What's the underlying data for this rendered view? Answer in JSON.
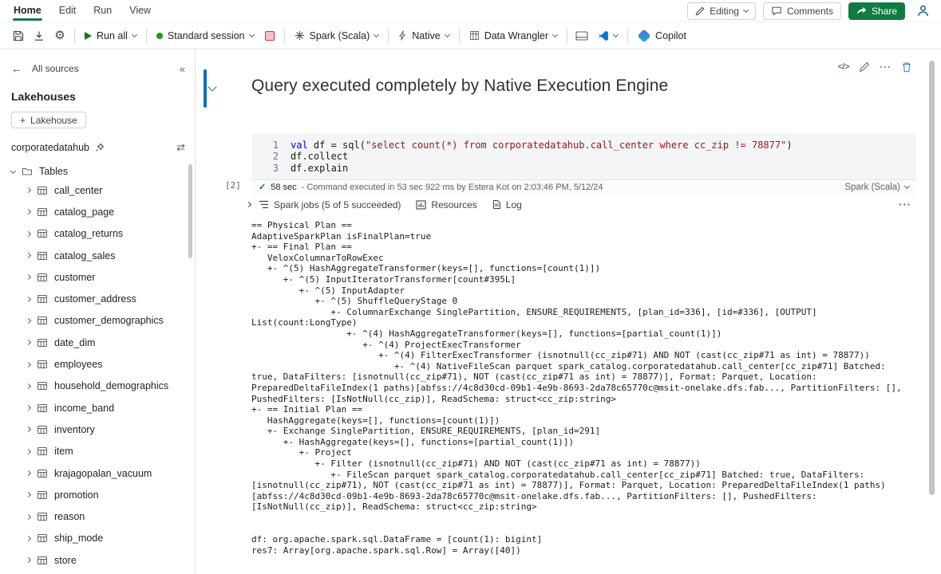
{
  "colors": {
    "accent_green": "#107c41",
    "tab_underline_green": "#117865",
    "run_green": "#107c10",
    "session_green": "#13a10e",
    "stop_red": "#d13438",
    "cell_accent_blue": "#0f6cbd",
    "keyword_blue": "#0000ff",
    "string_red": "#a31515",
    "vscode_blue": "#0078d4"
  },
  "icons": {
    "back": "←",
    "collapse_panel": "«",
    "plus": "+",
    "swap": "⇄",
    "gear": "⚙",
    "check": "✓",
    "code": "</>",
    "cell_more": "···",
    "output_more": "···"
  },
  "menubar": {
    "tabs": [
      "Home",
      "Edit",
      "Run",
      "View"
    ],
    "editing_label": "Editing",
    "comments_label": "Comments",
    "share_label": "Share"
  },
  "toolbar": {
    "run_all_label": "Run all",
    "session_label": "Standard session",
    "language_label": "Spark (Scala)",
    "native_label": "Native",
    "data_wrangler_label": "Data Wrangler",
    "copilot_label": "Copilot"
  },
  "sidebar": {
    "all_sources_label": "All sources",
    "section_title": "Lakehouses",
    "add_button_label": "Lakehouse",
    "lakehouse_name": "corporatedatahub",
    "tree_root_label": "Tables",
    "tables": [
      "call_center",
      "catalog_page",
      "catalog_returns",
      "catalog_sales",
      "customer",
      "customer_address",
      "customer_demographics",
      "date_dim",
      "employees",
      "household_demographics",
      "income_band",
      "inventory",
      "item",
      "krajagopalan_vacuum",
      "promotion",
      "reason",
      "ship_mode",
      "store"
    ]
  },
  "notebook": {
    "cell_title": "Query executed completely by Native Execution Engine",
    "execution_count": "[2]",
    "code_lines": [
      {
        "num": "1",
        "tokens": [
          {
            "t": "val",
            "c": "kw"
          },
          {
            "t": " df = sql(",
            "c": "plain"
          },
          {
            "t": "\"select count(*) from corporatedatahub.call_center where cc_zip != 78877\"",
            "c": "str"
          },
          {
            "t": ")",
            "c": "plain"
          }
        ]
      },
      {
        "num": "2",
        "tokens": [
          {
            "t": "df.collect",
            "c": "plain"
          }
        ]
      },
      {
        "num": "3",
        "tokens": [
          {
            "t": "df.explain",
            "c": "plain"
          }
        ]
      }
    ],
    "status": {
      "duration": "58 sec",
      "detail": "- Command executed in 53 sec 922 ms by Estera Kot on 2:03:46 PM, 5/12/24",
      "kernel": "Spark (Scala)"
    },
    "output_toolbar": {
      "spark_jobs_label": "Spark jobs (5 of 5 succeeded)",
      "resources_label": "Resources",
      "log_label": "Log"
    },
    "output_lines": [
      "== Physical Plan ==",
      "AdaptiveSparkPlan isFinalPlan=true",
      "+- == Final Plan ==",
      "   VeloxColumnarToRowExec",
      "   +- ^(5) HashAggregateTransformer(keys=[], functions=[count(1)])",
      "      +- ^(5) InputIteratorTransformer[count#395L]",
      "         +- ^(5) InputAdapter",
      "            +- ^(5) ShuffleQueryStage 0",
      "               +- ColumnarExchange SinglePartition, ENSURE_REQUIREMENTS, [plan_id=336], [id=#336], [OUTPUT] List(count:LongType)",
      "                  +- ^(4) HashAggregateTransformer(keys=[], functions=[partial_count(1)])",
      "                     +- ^(4) ProjectExecTransformer",
      "                        +- ^(4) FilterExecTransformer (isnotnull(cc_zip#71) AND NOT (cast(cc_zip#71 as int) = 78877))",
      "                           +- ^(4) NativeFileScan parquet spark_catalog.corporatedatahub.call_center[cc_zip#71] Batched: true, DataFilters: [isnotnull(cc_zip#71), NOT (cast(cc_zip#71 as int) = 78877)], Format: Parquet, Location: PreparedDeltaFileIndex(1 paths)[abfss://4c8d30cd-09b1-4e9b-8693-2da78c65770c@msit-onelake.dfs.fab..., PartitionFilters: [], PushedFilters: [IsNotNull(cc_zip)], ReadSchema: struct<cc_zip:string>",
      "+- == Initial Plan ==",
      "   HashAggregate(keys=[], functions=[count(1)])",
      "   +- Exchange SinglePartition, ENSURE_REQUIREMENTS, [plan_id=291]",
      "      +- HashAggregate(keys=[], functions=[partial_count(1)])",
      "         +- Project",
      "            +- Filter (isnotnull(cc_zip#71) AND NOT (cast(cc_zip#71 as int) = 78877))",
      "               +- FileScan parquet spark_catalog.corporatedatahub.call_center[cc_zip#71] Batched: true, DataFilters: [isnotnull(cc_zip#71), NOT (cast(cc_zip#71 as int) = 78877)], Format: Parquet, Location: PreparedDeltaFileIndex(1 paths)[abfss://4c8d30cd-09b1-4e9b-8693-2da78c65770c@msit-onelake.dfs.fab..., PartitionFilters: [], PushedFilters: [IsNotNull(cc_zip)], ReadSchema: struct<cc_zip:string>",
      "",
      "",
      "df: org.apache.spark.sql.DataFrame = [count(1): bigint]",
      "res7: Array[org.apache.spark.sql.Row] = Array([40])"
    ]
  }
}
